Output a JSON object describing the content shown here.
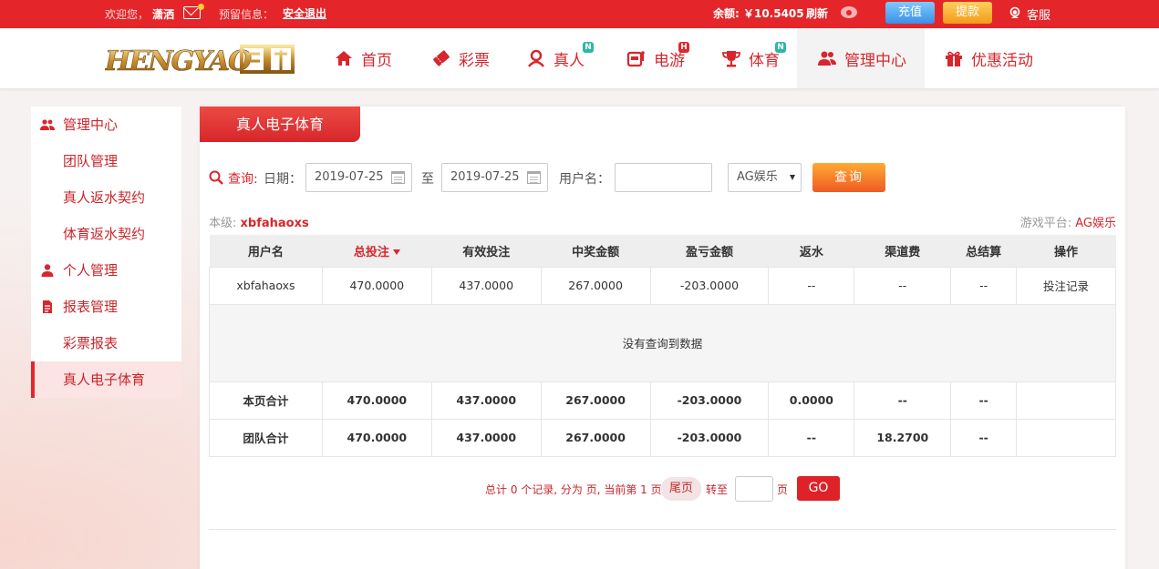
{
  "topbar": {
    "welcome": "欢迎您，",
    "username": "潇洒",
    "reserve_info": "预留信息：",
    "logout": "安全退出",
    "balance": "余额: ￥10.5405",
    "refresh": "刷新",
    "recharge": "充值",
    "withdraw": "提款",
    "service": "客服"
  },
  "nav": {
    "items": [
      {
        "label": "首页",
        "icon": "home-icon"
      },
      {
        "label": "彩票",
        "icon": "lottery-ticket-icon"
      },
      {
        "label": "真人",
        "icon": "dealer-icon",
        "badge": "N"
      },
      {
        "label": "电游",
        "icon": "slot-machine-icon",
        "badge": "H"
      },
      {
        "label": "体育",
        "icon": "trophy-icon",
        "badge": "N"
      },
      {
        "label": "管理中心",
        "icon": "users-icon"
      },
      {
        "label": "优惠活动",
        "icon": "gift-icon"
      }
    ]
  },
  "sidebar": {
    "items": [
      {
        "label": "管理中心",
        "type": "head",
        "icon": "users-icon"
      },
      {
        "label": "团队管理",
        "type": "sub"
      },
      {
        "label": "真人返水契约",
        "type": "sub"
      },
      {
        "label": "体育返水契约",
        "type": "sub"
      },
      {
        "label": "个人管理",
        "type": "head",
        "icon": "user-icon"
      },
      {
        "label": "报表管理",
        "type": "head",
        "icon": "report-icon"
      },
      {
        "label": "彩票报表",
        "type": "sub"
      },
      {
        "label": "真人电子体育",
        "type": "sub",
        "active": true
      }
    ]
  },
  "main": {
    "title": "真人电子体育",
    "query_label": "查询:",
    "date_label": "日期：",
    "date_from": "2019-07-25",
    "to_label": "至",
    "date_to": "2019-07-25",
    "username_label": "用户名：",
    "platform_select": "AG娱乐",
    "query_button": "查询",
    "level_label": "本级:",
    "level_value": "xbfahaoxs",
    "platform_label": "游戏平台:",
    "platform_value": "AG娱乐"
  },
  "table": {
    "columns": [
      "用户名",
      "总投注",
      "有效投注",
      "中奖金额",
      "盈亏金额",
      "返水",
      "渠道费",
      "总结算",
      "操作"
    ],
    "rows": [
      [
        "xbfahaoxs",
        "470.0000",
        "437.0000",
        "267.0000",
        "-203.0000",
        "--",
        "--",
        "--",
        "投注记录"
      ]
    ],
    "empty_text": "没有查询到数据",
    "page_total": [
      "本页合计",
      "470.0000",
      "437.0000",
      "267.0000",
      "-203.0000",
      "0.0000",
      "--",
      "--",
      ""
    ],
    "team_total": [
      "团队合计",
      "470.0000",
      "437.0000",
      "267.0000",
      "-203.0000",
      "--",
      "18.2700",
      "--",
      ""
    ]
  },
  "pager": {
    "info": "总计 0 个记录, 分为 页, 当前第 1 页",
    "last": "尾页",
    "goto": "转至",
    "page_unit": "页",
    "go": "GO"
  },
  "colors": {
    "brand_red": "#e4262a",
    "accent_orange": "#f19a1a",
    "accent_blue": "#3b8fe8"
  }
}
